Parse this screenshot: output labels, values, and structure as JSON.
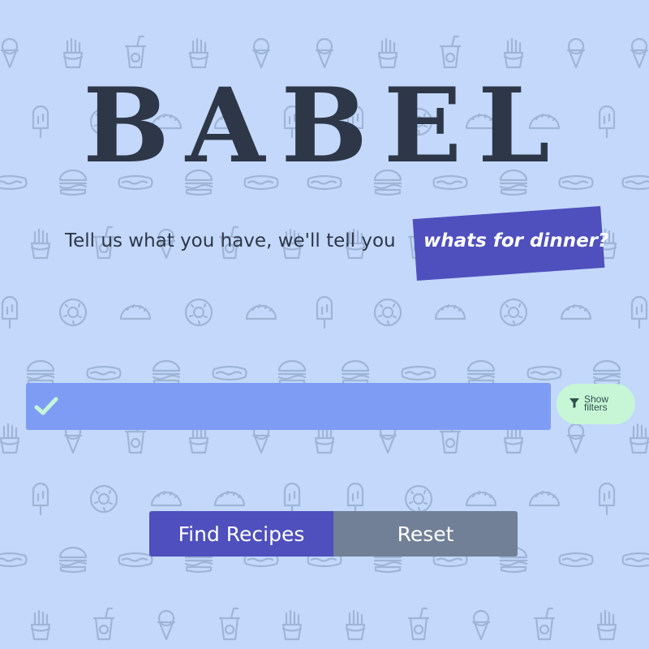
{
  "app": {
    "title": "BABEL",
    "tagline": "Tell us what you have, we'll tell you",
    "tagline_highlight": "whats for dinner?"
  },
  "search": {
    "value": "",
    "placeholder": "",
    "status_icon": "check-icon"
  },
  "filters": {
    "label": "Show filters",
    "icon": "filter-icon"
  },
  "actions": {
    "find_label": "Find Recipes",
    "reset_label": "Reset"
  },
  "background": {
    "pattern": "food-icons",
    "icons": [
      "ice-cream-icon",
      "fries-icon",
      "soda-cup-icon",
      "popsicle-icon",
      "donut-icon",
      "taco-icon",
      "burger-icon",
      "hotdog-icon"
    ]
  },
  "colors": {
    "background": "#c3d8fb",
    "title": "#2d3748",
    "accent": "#4f4fbd",
    "search_bar": "#7f9cf5",
    "check": "#c6f6d5",
    "filter_button": "#c6f6d5",
    "reset_button": "#718096"
  }
}
